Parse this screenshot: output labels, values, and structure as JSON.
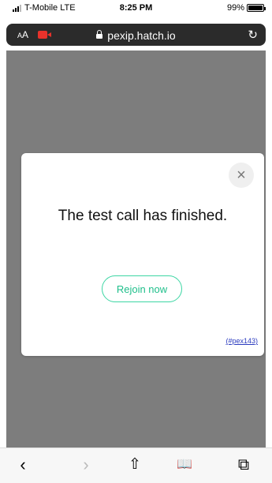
{
  "status_bar": {
    "carrier": "T-Mobile  LTE",
    "time": "8:25 PM",
    "battery": "99%",
    "battery_level": 0.99
  },
  "address_bar": {
    "text_size": "AA",
    "url": "pexip.hatch.io"
  },
  "dialog": {
    "message": "The test call has finished.",
    "rejoin_label": "Rejoin now",
    "error_code": "(#pex143)",
    "close_glyph": "×"
  },
  "toolbar": {
    "back": "‹",
    "forward": "›",
    "share": "⇧",
    "bookmarks": "📖",
    "tabs": "⧉"
  },
  "colors": {
    "overlay": "#7d7d7d",
    "accent": "#3dd6a4",
    "camera": "#e8322b",
    "link": "#2b3bbf"
  }
}
